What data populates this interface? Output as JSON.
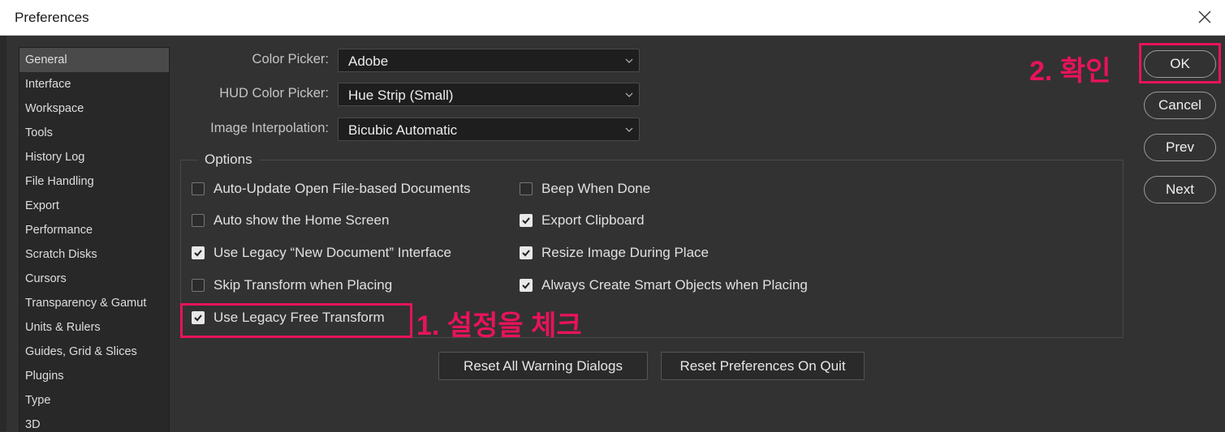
{
  "window": {
    "title": "Preferences"
  },
  "sidebar": {
    "items": [
      {
        "label": "General",
        "selected": true
      },
      {
        "label": "Interface"
      },
      {
        "label": "Workspace"
      },
      {
        "label": "Tools"
      },
      {
        "label": "History Log"
      },
      {
        "label": "File Handling"
      },
      {
        "label": "Export"
      },
      {
        "label": "Performance"
      },
      {
        "label": "Scratch Disks"
      },
      {
        "label": "Cursors"
      },
      {
        "label": "Transparency & Gamut"
      },
      {
        "label": "Units & Rulers"
      },
      {
        "label": "Guides, Grid & Slices"
      },
      {
        "label": "Plugins"
      },
      {
        "label": "Type"
      },
      {
        "label": "3D"
      }
    ]
  },
  "general": {
    "color_picker": {
      "label": "Color Picker:",
      "value": "Adobe"
    },
    "hud_color_picker": {
      "label": "HUD Color Picker:",
      "value": "Hue Strip (Small)"
    },
    "image_interpolation": {
      "label": "Image Interpolation:",
      "value": "Bicubic Automatic"
    }
  },
  "options": {
    "title": "Options",
    "left": [
      {
        "label": "Auto-Update Open File-based Documents",
        "checked": false
      },
      {
        "label": "Auto show the Home Screen",
        "checked": false
      },
      {
        "label": "Use Legacy “New Document” Interface",
        "checked": true
      },
      {
        "label": "Skip Transform when Placing",
        "checked": false
      },
      {
        "label": "Use Legacy Free Transform",
        "checked": true
      }
    ],
    "right": [
      {
        "label": "Beep When Done",
        "checked": false
      },
      {
        "label": "Export Clipboard",
        "checked": true
      },
      {
        "label": "Resize Image During Place",
        "checked": true
      },
      {
        "label": "Always Create Smart Objects when Placing",
        "checked": true
      }
    ]
  },
  "reset": {
    "warnings_label": "Reset All Warning Dialogs",
    "prefs_label": "Reset Preferences On Quit"
  },
  "buttons": {
    "ok": "OK",
    "cancel": "Cancel",
    "prev": "Prev",
    "next": "Next"
  },
  "annotations": {
    "step1": "1. 설정을 체크",
    "step2": "2. 확인",
    "color": "#e8135a"
  },
  "icons": [
    "close-icon",
    "chevron-down-icon",
    "checkmark-icon"
  ]
}
